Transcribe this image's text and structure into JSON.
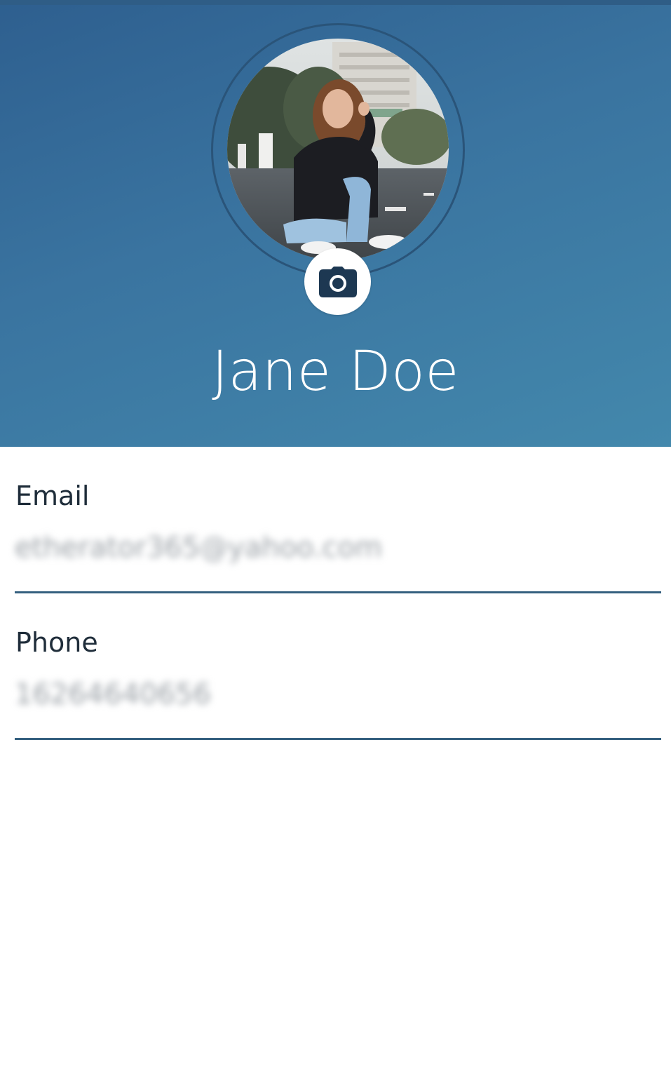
{
  "profile": {
    "name": "Jane Doe",
    "avatar_alt": "profile photo",
    "camera_icon": "camera-icon"
  },
  "fields": {
    "email": {
      "label": "Email",
      "value": "etherator365@yahoo.com"
    },
    "phone": {
      "label": "Phone",
      "value": "16264640656"
    }
  },
  "colors": {
    "header_start": "#2e5f8f",
    "header_end": "#4388ac",
    "label_text": "#1f2d3a",
    "underline": "#35607f"
  }
}
